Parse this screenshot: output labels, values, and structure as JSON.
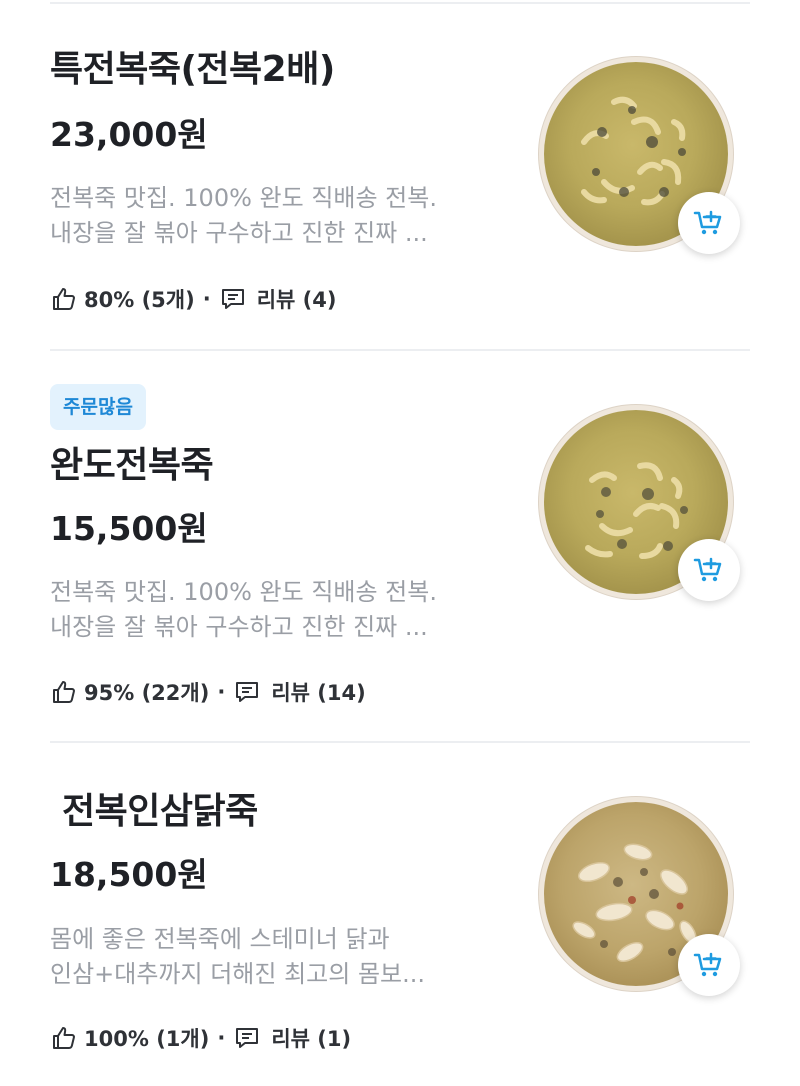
{
  "menu_items": [
    {
      "badge": "",
      "title": "특전복죽(전복2배)",
      "price": "23,000원",
      "description_lines": [
        "전복죽 맛집. 100% 완도 직배송 전복.",
        "내장을 잘 볶아 구수하고 진한 진짜 ..."
      ],
      "like_rate": "80% (5개)",
      "separator": "·",
      "review_label": "리뷰 (4)",
      "thumbnail": "abalone-porridge-bowl",
      "cart_icon": "add-to-cart-icon"
    },
    {
      "badge": "주문많음",
      "title": "완도전복죽",
      "price": "15,500원",
      "description_lines": [
        "전복죽 맛집. 100% 완도 직배송 전복.",
        "내장을 잘 볶아 구수하고 진한 진짜 ..."
      ],
      "like_rate": "95% (22개)",
      "separator": "·",
      "review_label": "리뷰 (14)",
      "thumbnail": "abalone-porridge-bowl",
      "cart_icon": "add-to-cart-icon"
    },
    {
      "badge": "",
      "title": " 전복인삼닭죽",
      "price": "18,500원",
      "description_lines": [
        "몸에 좋은 전복죽에 스테미너 닭과",
        "인삼+대추까지 더해진 최고의 몸보..."
      ],
      "like_rate": "100% (1개)",
      "separator": "·",
      "review_label": "리뷰 (1)",
      "thumbnail": "chicken-ginseng-abalone-porridge-bowl",
      "cart_icon": "add-to-cart-icon"
    }
  ],
  "colors": {
    "badge_bg": "#e3f2fd",
    "badge_text": "#1e88d6",
    "cart_icon": "#1e9be0",
    "description": "#9a9ea5",
    "text": "#1f2126"
  }
}
